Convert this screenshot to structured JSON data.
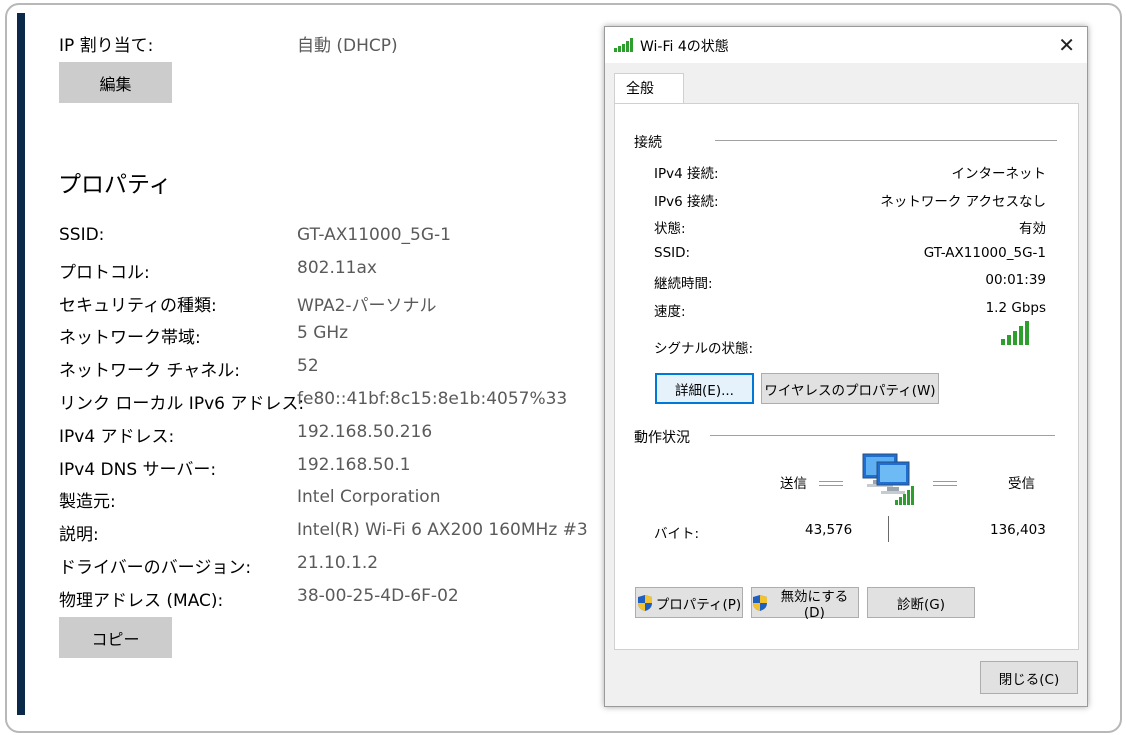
{
  "settings": {
    "ip_assign_label": "IP 割り当て:",
    "ip_assign_value": "自動 (DHCP)",
    "edit_button": "編集",
    "properties_title": "プロパティ",
    "rows": [
      {
        "label": "SSID:",
        "value": "GT-AX11000_5G-1"
      },
      {
        "label": "プロトコル:",
        "value": "802.11ax"
      },
      {
        "label": "セキュリティの種類:",
        "value": "WPA2-パーソナル"
      },
      {
        "label": "ネットワーク帯域:",
        "value": "5 GHz"
      },
      {
        "label": "ネットワーク チャネル:",
        "value": "52"
      },
      {
        "label": "リンク ローカル IPv6 アドレス:",
        "value": "fe80::41bf:8c15:8e1b:4057%33"
      },
      {
        "label": "IPv4 アドレス:",
        "value": "192.168.50.216"
      },
      {
        "label": "IPv4 DNS サーバー:",
        "value": "192.168.50.1"
      },
      {
        "label": "製造元:",
        "value": "Intel Corporation"
      },
      {
        "label": "説明:",
        "value": "Intel(R) Wi-Fi 6 AX200 160MHz #3"
      },
      {
        "label": "ドライバーのバージョン:",
        "value": "21.10.1.2"
      },
      {
        "label": "物理アドレス (MAC):",
        "value": "38-00-25-4D-6F-02"
      }
    ],
    "copy_button": "コピー"
  },
  "dialog": {
    "title": "Wi-Fi 4の状態",
    "close_glyph": "✕",
    "tab_general": "全般",
    "connection_group": "接続",
    "connection": [
      {
        "label": "IPv4 接続:",
        "value": "インターネット"
      },
      {
        "label": "IPv6 接続:",
        "value": "ネットワーク アクセスなし"
      },
      {
        "label": "状態:",
        "value": "有効"
      },
      {
        "label": "SSID:",
        "value": "GT-AX11000_5G-1"
      },
      {
        "label": "継続時間:",
        "value": "00:01:39"
      },
      {
        "label": "速度:",
        "value": "1.2 Gbps"
      }
    ],
    "signal_label": "シグナルの状態:",
    "details_button": "詳細(E)...",
    "wireless_props_button": "ワイヤレスのプロパティ(W)",
    "activity_group": "動作状況",
    "sent_label": "送信",
    "received_label": "受信",
    "bytes_label": "バイト:",
    "bytes_sent": "43,576",
    "bytes_received": "136,403",
    "properties_button": "プロパティ(P)",
    "disable_button": "無効にする(D)",
    "diagnose_button": "診断(G)",
    "close_button": "閉じる(C)"
  },
  "colors": {
    "sidebar_accent": "#0b2a4a",
    "signal_green": "#2e9e2e",
    "focus_blue": "#0078d7"
  }
}
